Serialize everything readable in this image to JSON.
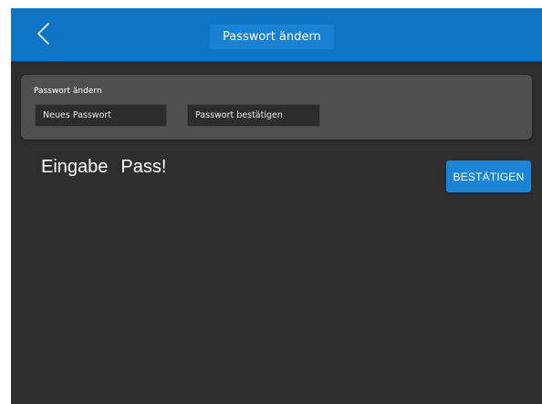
{
  "header": {
    "back_icon": "chevron-left-icon",
    "title": "Passwort ändern"
  },
  "form": {
    "section_label": "Passwort ändern",
    "new_password": {
      "value": "",
      "placeholder": "Neues Passwort"
    },
    "confirm_password": {
      "value": "",
      "placeholder": "Passwort bestätigen"
    }
  },
  "status": {
    "label": "Eingabe",
    "message": "Pass!"
  },
  "actions": {
    "confirm_label": "BESTÄTIGEN"
  },
  "colors": {
    "header_bg": "#0f74c4",
    "screen_bg": "#2e2e2e",
    "panel_bg": "#4f4f4f",
    "field_bg": "#2d2d2d",
    "button_bg": "#1a85d4",
    "text": "#ffffff"
  }
}
